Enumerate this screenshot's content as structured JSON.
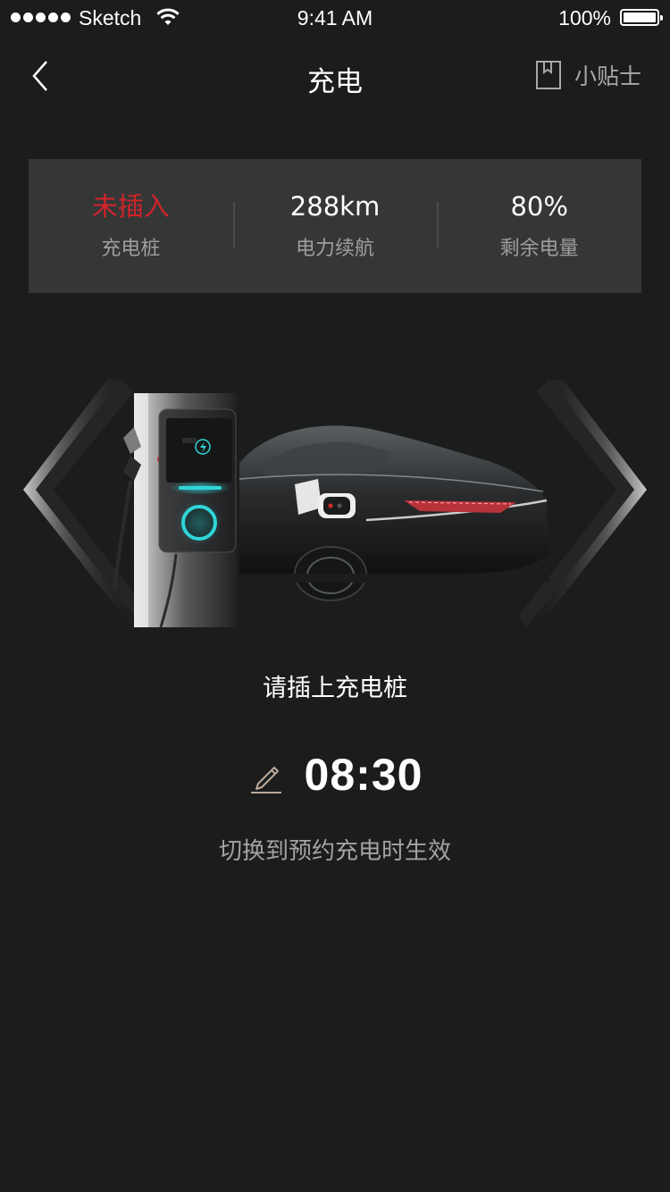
{
  "status_bar": {
    "carrier": "Sketch",
    "time": "9:41 AM",
    "battery": "100%"
  },
  "nav": {
    "title": "充电",
    "tips_label": "小贴士",
    "back_icon": "chevron-left-icon",
    "tips_icon": "bookmark-icon"
  },
  "info": [
    {
      "value": "未插入",
      "label": "充电桩",
      "color": "#d0232b"
    },
    {
      "value": "288km",
      "label": "电力续航"
    },
    {
      "value": "80%",
      "label": "剩余电量"
    }
  ],
  "main": {
    "prompt": "请插上充电桩",
    "time": "08:30",
    "hint": "切换到预约充电时生效",
    "accent": "#2fd6d8"
  }
}
